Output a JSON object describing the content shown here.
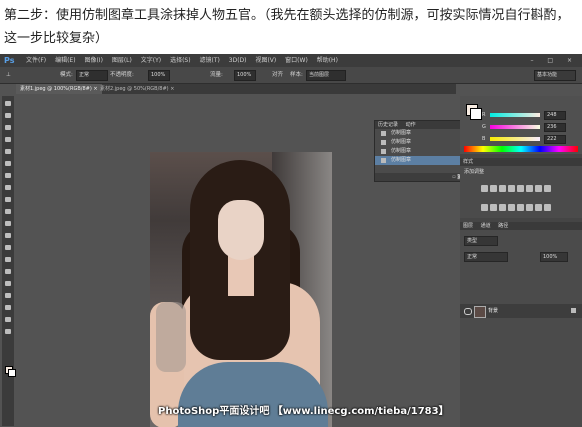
{
  "caption": "第二步：使用仿制图章工具涂抹掉人物五官。（我先在额头选择的仿制源，可按实际情况自行斟酌，这一步比较复杂）",
  "app": {
    "logo": "Ps",
    "menus": [
      "文件(F)",
      "编辑(E)",
      "图像(I)",
      "图层(L)",
      "文字(Y)",
      "选择(S)",
      "滤镜(T)",
      "3D(D)",
      "视图(V)",
      "窗口(W)",
      "帮助(H)"
    ],
    "window_buttons": "– □ ×"
  },
  "options": {
    "mode_label": "模式:",
    "mode_value": "正常",
    "opacity_label": "不透明度:",
    "opacity_value": "100%",
    "flow_label": "流量:",
    "flow_value": "100%",
    "aligned_label": "对齐",
    "sample_label": "样本:",
    "sample_value": "当前图层",
    "workspace": "基本功能"
  },
  "tabs": [
    {
      "label": "素材1.jpeg @ 100%(RGB/8#) ×"
    },
    {
      "label": "素材2.jpeg @ 50%(RGB/8#) ×"
    }
  ],
  "history": {
    "tab1": "历史记录",
    "tab2": "动作",
    "items": [
      "仿制图章",
      "仿制图章",
      "仿制图章",
      "仿制图章"
    ]
  },
  "color": {
    "r": "248",
    "g": "236",
    "b": "222",
    "fg": "#f8ece2"
  },
  "adjustments": {
    "tab": "样式",
    "title": "添加调整"
  },
  "layers": {
    "tabs": [
      "图层",
      "通道",
      "路径"
    ],
    "kind": "类型",
    "blend": "正常",
    "opacity": "100%",
    "layer_name": "背景"
  },
  "watermark": "PhotoShop平面设计吧 【www.linecg.com/tieba/1783】"
}
